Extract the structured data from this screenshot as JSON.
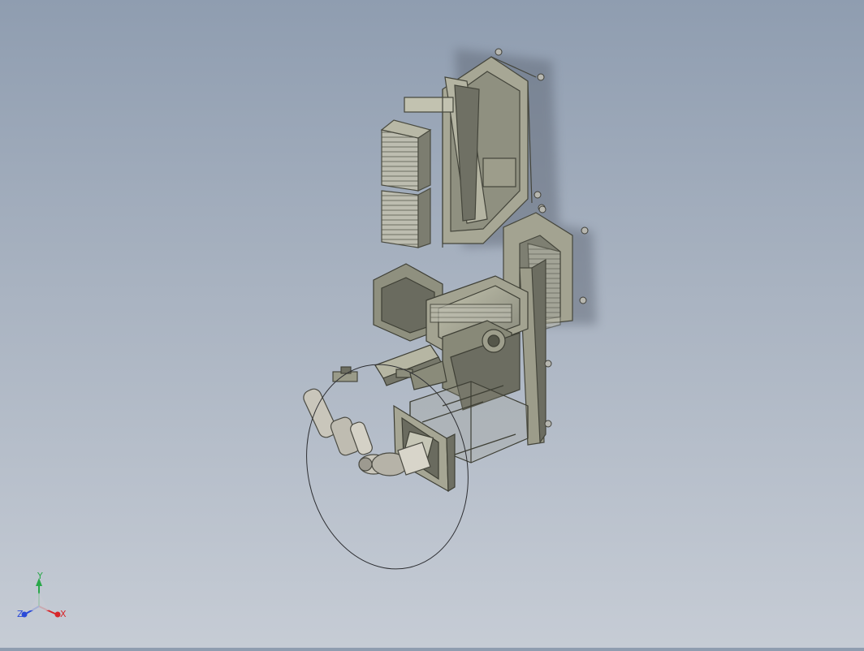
{
  "viewport": {
    "background_top": "#8f9db0",
    "background_bottom": "#c6ccd5",
    "model_fill": "#9a9a86",
    "model_dark": "#55564a",
    "model_light": "#c8c8b4"
  },
  "triad": {
    "x_label": "X",
    "y_label": "Y",
    "z_label": "Z",
    "x_color": "#d8262a",
    "y_color": "#2aa84a",
    "z_color": "#2a4ad8"
  }
}
